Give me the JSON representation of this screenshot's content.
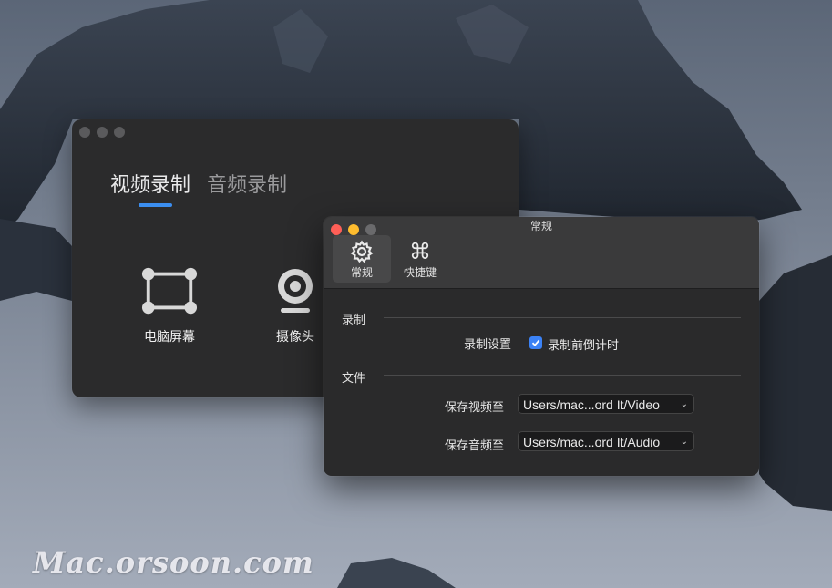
{
  "watermark": "Mac.orsoon.com",
  "main_window": {
    "tabs": [
      {
        "label": "视频录制",
        "active": true
      },
      {
        "label": "音频录制",
        "active": false
      }
    ],
    "accent_color": "#3b8ef0",
    "sources": [
      {
        "label": "电脑屏幕",
        "icon": "screen-capture-icon"
      },
      {
        "label": "摄像头",
        "icon": "webcam-icon"
      }
    ]
  },
  "pref_window": {
    "title": "常规",
    "toolbar": [
      {
        "label": "常规",
        "icon": "gear-icon",
        "active": true
      },
      {
        "label": "快捷键",
        "icon": "command-key-icon",
        "active": false
      }
    ],
    "sections": {
      "record": {
        "title": "录制",
        "setting_label": "录制设置",
        "checkbox_label": "录制前倒计时",
        "checkbox_checked": true
      },
      "file": {
        "title": "文件",
        "video_label": "保存视频至",
        "video_path": "Users/mac...ord It/Video",
        "audio_label": "保存音频至",
        "audio_path": "Users/mac...ord It/Audio"
      }
    }
  }
}
